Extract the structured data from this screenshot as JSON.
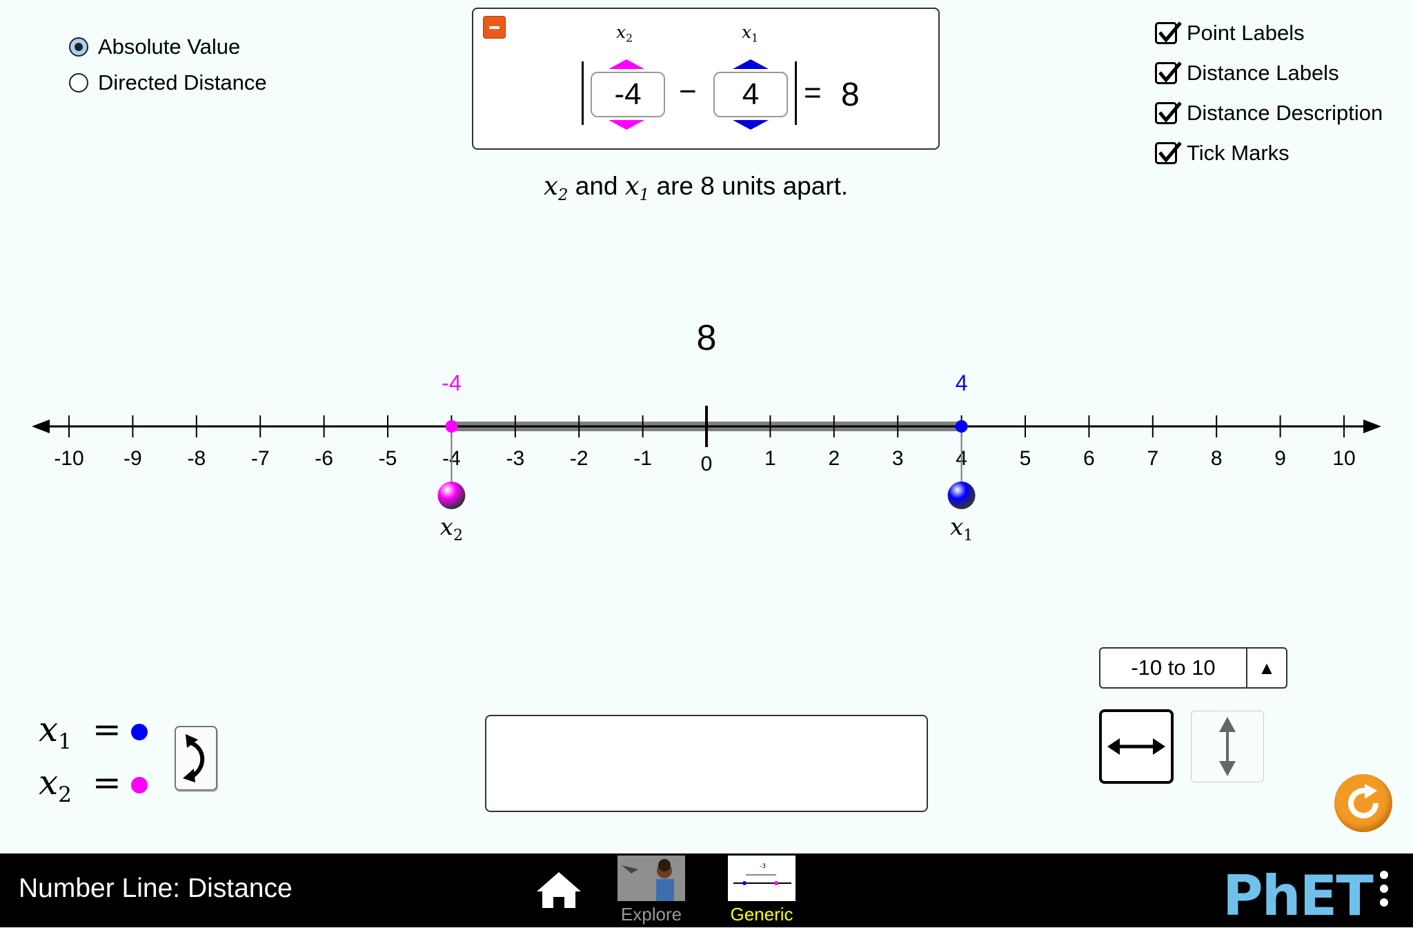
{
  "distance_mode": {
    "options": [
      {
        "label": "Absolute Value",
        "selected": true
      },
      {
        "label": "Directed Distance",
        "selected": false
      }
    ]
  },
  "equation": {
    "x2_label": "x",
    "x2_sub": "2",
    "x1_label": "x",
    "x1_sub": "1",
    "x2_value": "-4",
    "x1_value": "4",
    "minus": "−",
    "equals": "=",
    "result": "8"
  },
  "description": {
    "var_a": "x",
    "sub_a": "2",
    "and": "and",
    "var_b": "x",
    "sub_b": "1",
    "text": "are 8 units apart."
  },
  "options": {
    "point_labels": "Point Labels",
    "distance_labels": "Distance Labels",
    "distance_description": "Distance Description",
    "tick_marks": "Tick Marks"
  },
  "number_line": {
    "min": -10,
    "max": 10,
    "tick_labels": [
      "-10",
      "-9",
      "-8",
      "-7",
      "-6",
      "-5",
      "-4",
      "-3",
      "-2",
      "-1",
      "0",
      "1",
      "2",
      "3",
      "4",
      "5",
      "6",
      "7",
      "8",
      "9",
      "10"
    ],
    "distance_label": "8",
    "points": [
      {
        "name": "x",
        "sub": "2",
        "value": -4,
        "value_label": "-4",
        "color": "#ff00ff"
      },
      {
        "name": "x",
        "sub": "1",
        "value": 4,
        "value_label": "4",
        "color": "#0000ff"
      }
    ],
    "segment_color": "#808080"
  },
  "legend": {
    "x1_var": "x",
    "x1_sub": "1",
    "x2_var": "x",
    "x2_sub": "2",
    "eq": "=",
    "x1_color": "#0000ff",
    "x2_color": "#ff00ff",
    "swap_icon": "swap-arrow-icon"
  },
  "range_selector": {
    "value": "-10 to 10",
    "arrow": "▲"
  },
  "orientation": {
    "horizontal": "horizontal-arrows-icon",
    "vertical": "vertical-arrows-icon",
    "selected": "horizontal"
  },
  "reset_icon": "reset-icon",
  "navbar": {
    "title": "Number Line: Distance",
    "home_icon": "home-icon",
    "screens": [
      {
        "label": "Explore",
        "active": false
      },
      {
        "label": "Generic",
        "active": true
      }
    ],
    "logo": "PhET",
    "menu_icon": "kebab-menu-icon",
    "thumb_label": "-3",
    "colors": {
      "active": "#ffff00",
      "inactive": "#999999"
    }
  }
}
